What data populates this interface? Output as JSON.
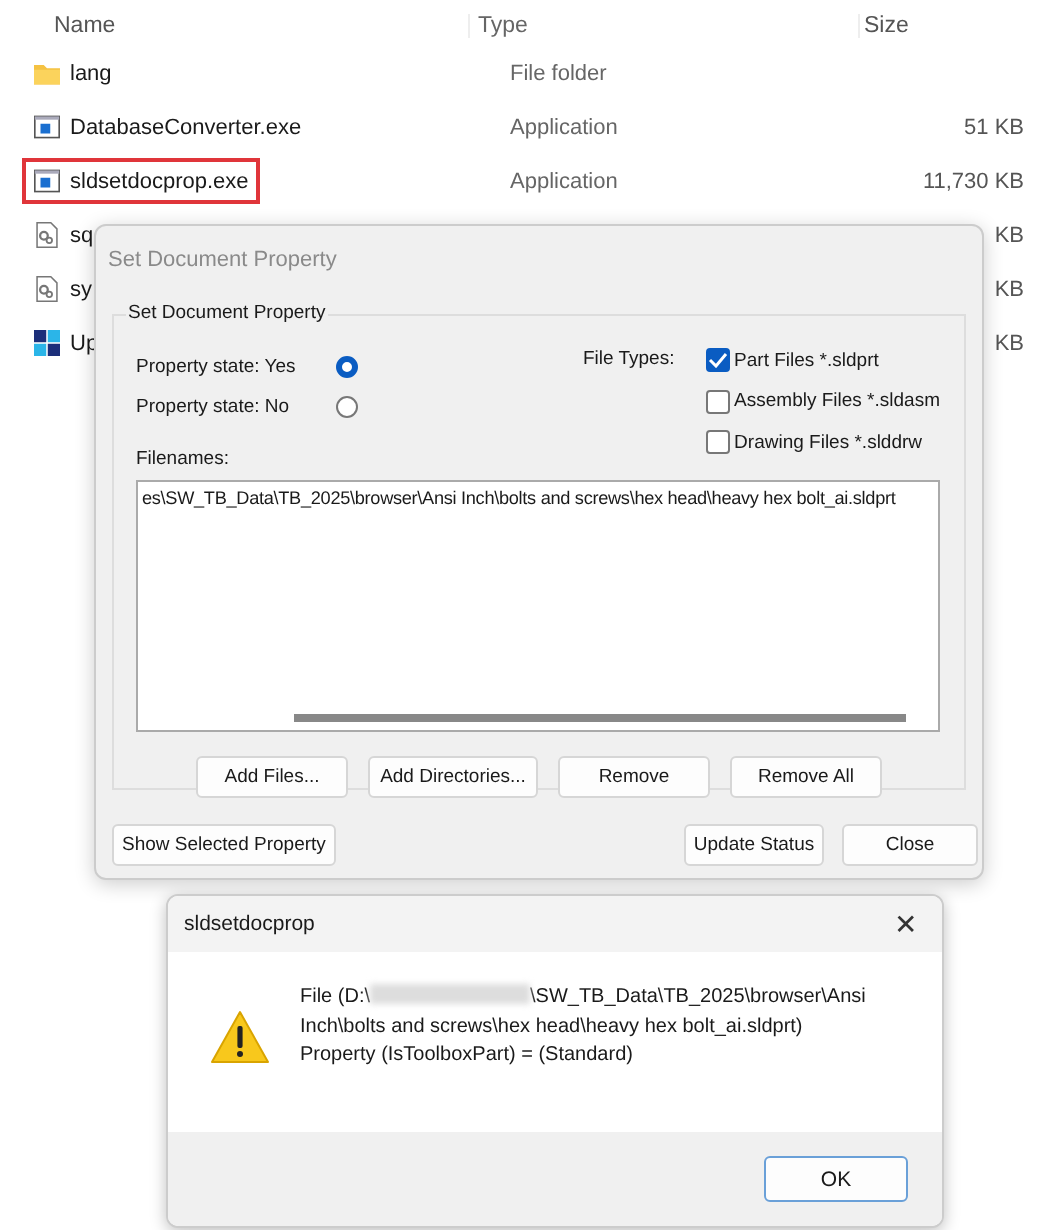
{
  "explorer": {
    "columns": [
      "Name",
      "Type",
      "Size"
    ],
    "rows": [
      {
        "name": "lang",
        "type": "File folder",
        "kind": "folder",
        "highlighted": false
      },
      {
        "name": "DatabaseConverter.exe",
        "type": "Application",
        "size": "51 KB",
        "kind": "app",
        "highlighted": false
      },
      {
        "name": "sldsetdocprop.exe",
        "type": "Application",
        "size": "11,730 KB",
        "kind": "app",
        "highlighted": true
      },
      {
        "name": "sq",
        "size": "KB",
        "kind": "config",
        "highlighted": false
      },
      {
        "name": "sy",
        "size": "KB",
        "kind": "config",
        "highlighted": false
      },
      {
        "name": "Up",
        "size": "KB",
        "kind": "installer",
        "highlighted": false
      }
    ]
  },
  "dialog": {
    "title": "Set Document Property",
    "group_label": "Set Document Property",
    "property_states": [
      {
        "label": "Property state: Yes",
        "selected": true
      },
      {
        "label": "Property state: No",
        "selected": false
      }
    ],
    "file_types_label": "File Types:",
    "file_types": [
      {
        "label": "Part Files *.sldprt",
        "checked": true
      },
      {
        "label": "Assembly Files *.sldasm",
        "checked": false
      },
      {
        "label": "Drawing Files *.slddrw",
        "checked": false
      }
    ],
    "filenames_label": "Filenames:",
    "filenames": [
      "es\\SW_TB_Data\\TB_2025\\browser\\Ansi Inch\\bolts and screws\\hex head\\heavy hex bolt_ai.sldprt"
    ],
    "list_buttons": [
      "Add Files...",
      "Add Directories...",
      "Remove",
      "Remove All"
    ],
    "left_button": "Show Selected Property",
    "right_buttons": [
      "Update Status",
      "Close"
    ]
  },
  "message_box": {
    "title": "sldsetdocprop",
    "close": "✕",
    "message_start": "File (D:\\",
    "message_end": "\\SW_TB_Data\\TB_2025\\browser\\Ansi Inch\\bolts and screws\\hex head\\heavy hex bolt_ai.sldprt) Property (IsToolboxPart) = (Standard)",
    "button": "OK"
  }
}
